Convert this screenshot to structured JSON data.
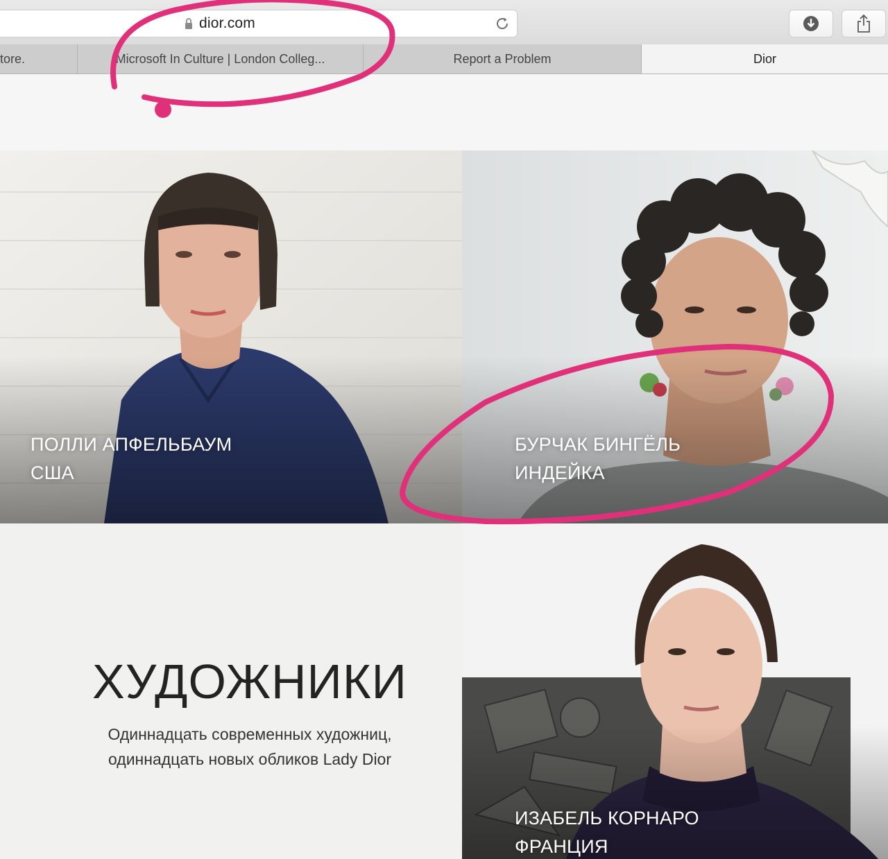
{
  "browser": {
    "address": "dior.com",
    "tabs": [
      {
        "label": "tore."
      },
      {
        "label": "Microsoft In Culture | London Colleg..."
      },
      {
        "label": "Report a Problem"
      },
      {
        "label": "Dior"
      }
    ],
    "icons": {
      "lock": "lock-icon",
      "reload": "reload-icon",
      "download": "download-icon",
      "share": "share-icon"
    }
  },
  "artists": [
    {
      "name": "ПОЛЛИ АПФЕЛЬБАУМ",
      "country": "США"
    },
    {
      "name": "БУРЧАК БИНГЁЛЬ",
      "country": "ИНДЕЙКА"
    },
    {
      "name": "ИЗАБЕЛЬ КОРНАРО",
      "country": "ФРАНЦИЯ"
    }
  ],
  "intro": {
    "title": "ХУДОЖНИКИ",
    "subtitle_line1": "Одиннадцать современных художниц,",
    "subtitle_line2": "одиннадцать новых обликов Lady Dior"
  },
  "colors": {
    "annotation": "#e1307a",
    "shirt_navy": "#2c3a6b",
    "chrome": "#dcdcdc"
  }
}
